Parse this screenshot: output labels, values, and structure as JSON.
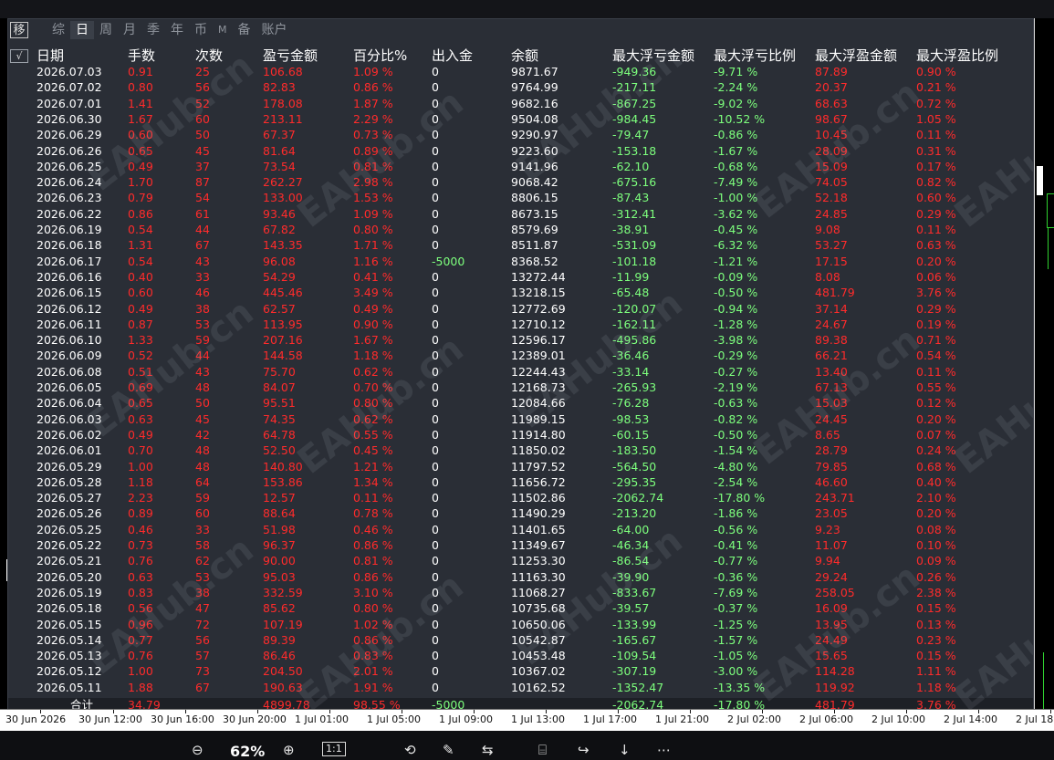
{
  "tabs": {
    "move": "移",
    "items": [
      "综",
      "日",
      "周",
      "月",
      "季",
      "年",
      "币",
      "M",
      "备",
      "账户"
    ],
    "active_index": 1
  },
  "check_label": "√",
  "headers": [
    "日期",
    "手数",
    "次数",
    "盈亏金额",
    "百分比%",
    "出入金",
    "余额",
    "最大浮亏金额",
    "最大浮亏比例",
    "最大浮盈金额",
    "最大浮盈比例"
  ],
  "rows": [
    [
      "2026.07.03",
      "0.91",
      "25",
      "106.68",
      "1.09 %",
      "0",
      "9871.67",
      "-949.36",
      "-9.71 %",
      "87.89",
      "0.90 %"
    ],
    [
      "2026.07.02",
      "0.80",
      "56",
      "82.83",
      "0.86 %",
      "0",
      "9764.99",
      "-217.11",
      "-2.24 %",
      "20.37",
      "0.21 %"
    ],
    [
      "2026.07.01",
      "1.41",
      "52",
      "178.08",
      "1.87 %",
      "0",
      "9682.16",
      "-867.25",
      "-9.02 %",
      "68.63",
      "0.72 %"
    ],
    [
      "2026.06.30",
      "1.67",
      "60",
      "213.11",
      "2.29 %",
      "0",
      "9504.08",
      "-984.45",
      "-10.52 %",
      "98.67",
      "1.05 %"
    ],
    [
      "2026.06.29",
      "0.60",
      "50",
      "67.37",
      "0.73 %",
      "0",
      "9290.97",
      "-79.47",
      "-0.86 %",
      "10.45",
      "0.11 %"
    ],
    [
      "2026.06.26",
      "0.65",
      "45",
      "81.64",
      "0.89 %",
      "0",
      "9223.60",
      "-153.18",
      "-1.67 %",
      "28.09",
      "0.31 %"
    ],
    [
      "2026.06.25",
      "0.49",
      "37",
      "73.54",
      "0.81 %",
      "0",
      "9141.96",
      "-62.10",
      "-0.68 %",
      "15.09",
      "0.17 %"
    ],
    [
      "2026.06.24",
      "1.70",
      "87",
      "262.27",
      "2.98 %",
      "0",
      "9068.42",
      "-675.16",
      "-7.49 %",
      "74.05",
      "0.82 %"
    ],
    [
      "2026.06.23",
      "0.79",
      "54",
      "133.00",
      "1.53 %",
      "0",
      "8806.15",
      "-87.43",
      "-1.00 %",
      "52.18",
      "0.60 %"
    ],
    [
      "2026.06.22",
      "0.86",
      "61",
      "93.46",
      "1.09 %",
      "0",
      "8673.15",
      "-312.41",
      "-3.62 %",
      "24.85",
      "0.29 %"
    ],
    [
      "2026.06.19",
      "0.54",
      "44",
      "67.82",
      "0.80 %",
      "0",
      "8579.69",
      "-38.91",
      "-0.45 %",
      "9.08",
      "0.11 %"
    ],
    [
      "2026.06.18",
      "1.31",
      "67",
      "143.35",
      "1.71 %",
      "0",
      "8511.87",
      "-531.09",
      "-6.32 %",
      "53.27",
      "0.63 %"
    ],
    [
      "2026.06.17",
      "0.54",
      "43",
      "96.08",
      "1.16 %",
      "-5000",
      "8368.52",
      "-101.18",
      "-1.21 %",
      "17.15",
      "0.20 %"
    ],
    [
      "2026.06.16",
      "0.40",
      "33",
      "54.29",
      "0.41 %",
      "0",
      "13272.44",
      "-11.99",
      "-0.09 %",
      "8.08",
      "0.06 %"
    ],
    [
      "2026.06.15",
      "0.60",
      "46",
      "445.46",
      "3.49 %",
      "0",
      "13218.15",
      "-65.48",
      "-0.50 %",
      "481.79",
      "3.76 %"
    ],
    [
      "2026.06.12",
      "0.49",
      "38",
      "62.57",
      "0.49 %",
      "0",
      "12772.69",
      "-120.07",
      "-0.94 %",
      "37.14",
      "0.29 %"
    ],
    [
      "2026.06.11",
      "0.87",
      "53",
      "113.95",
      "0.90 %",
      "0",
      "12710.12",
      "-162.11",
      "-1.28 %",
      "24.67",
      "0.19 %"
    ],
    [
      "2026.06.10",
      "1.33",
      "59",
      "207.16",
      "1.67 %",
      "0",
      "12596.17",
      "-495.86",
      "-3.98 %",
      "89.38",
      "0.71 %"
    ],
    [
      "2026.06.09",
      "0.52",
      "44",
      "144.58",
      "1.18 %",
      "0",
      "12389.01",
      "-36.46",
      "-0.29 %",
      "66.21",
      "0.54 %"
    ],
    [
      "2026.06.08",
      "0.51",
      "43",
      "75.70",
      "0.62 %",
      "0",
      "12244.43",
      "-33.14",
      "-0.27 %",
      "13.40",
      "0.11 %"
    ],
    [
      "2026.06.05",
      "0.69",
      "48",
      "84.07",
      "0.70 %",
      "0",
      "12168.73",
      "-265.93",
      "-2.19 %",
      "67.13",
      "0.55 %"
    ],
    [
      "2026.06.04",
      "0.65",
      "50",
      "95.51",
      "0.80 %",
      "0",
      "12084.66",
      "-76.28",
      "-0.63 %",
      "15.03",
      "0.12 %"
    ],
    [
      "2026.06.03",
      "0.63",
      "45",
      "74.35",
      "0.62 %",
      "0",
      "11989.15",
      "-98.53",
      "-0.82 %",
      "24.45",
      "0.20 %"
    ],
    [
      "2026.06.02",
      "0.49",
      "42",
      "64.78",
      "0.55 %",
      "0",
      "11914.80",
      "-60.15",
      "-0.50 %",
      "8.65",
      "0.07 %"
    ],
    [
      "2026.06.01",
      "0.70",
      "48",
      "52.50",
      "0.45 %",
      "0",
      "11850.02",
      "-183.50",
      "-1.54 %",
      "28.79",
      "0.24 %"
    ],
    [
      "2026.05.29",
      "1.00",
      "48",
      "140.80",
      "1.21 %",
      "0",
      "11797.52",
      "-564.50",
      "-4.80 %",
      "79.85",
      "0.68 %"
    ],
    [
      "2026.05.28",
      "1.18",
      "64",
      "153.86",
      "1.34 %",
      "0",
      "11656.72",
      "-295.35",
      "-2.54 %",
      "46.60",
      "0.40 %"
    ],
    [
      "2026.05.27",
      "2.23",
      "59",
      "12.57",
      "0.11 %",
      "0",
      "11502.86",
      "-2062.74",
      "-17.80 %",
      "243.71",
      "2.10 %"
    ],
    [
      "2026.05.26",
      "0.89",
      "60",
      "88.64",
      "0.78 %",
      "0",
      "11490.29",
      "-213.20",
      "-1.86 %",
      "23.05",
      "0.20 %"
    ],
    [
      "2026.05.25",
      "0.46",
      "33",
      "51.98",
      "0.46 %",
      "0",
      "11401.65",
      "-64.00",
      "-0.56 %",
      "9.23",
      "0.08 %"
    ],
    [
      "2026.05.22",
      "0.73",
      "58",
      "96.37",
      "0.86 %",
      "0",
      "11349.67",
      "-46.34",
      "-0.41 %",
      "11.07",
      "0.10 %"
    ],
    [
      "2026.05.21",
      "0.76",
      "62",
      "90.00",
      "0.81 %",
      "0",
      "11253.30",
      "-86.54",
      "-0.77 %",
      "9.94",
      "0.09 %"
    ],
    [
      "2026.05.20",
      "0.63",
      "53",
      "95.03",
      "0.86 %",
      "0",
      "11163.30",
      "-39.90",
      "-0.36 %",
      "29.24",
      "0.26 %"
    ],
    [
      "2026.05.19",
      "0.83",
      "38",
      "332.59",
      "3.10 %",
      "0",
      "11068.27",
      "-833.67",
      "-7.69 %",
      "258.05",
      "2.38 %"
    ],
    [
      "2026.05.18",
      "0.56",
      "47",
      "85.62",
      "0.80 %",
      "0",
      "10735.68",
      "-39.57",
      "-0.37 %",
      "16.09",
      "0.15 %"
    ],
    [
      "2026.05.15",
      "0.96",
      "72",
      "107.19",
      "1.02 %",
      "0",
      "10650.06",
      "-133.99",
      "-1.25 %",
      "13.95",
      "0.13 %"
    ],
    [
      "2026.05.14",
      "0.77",
      "56",
      "89.39",
      "0.86 %",
      "0",
      "10542.87",
      "-165.67",
      "-1.57 %",
      "24.49",
      "0.23 %"
    ],
    [
      "2026.05.13",
      "0.76",
      "57",
      "86.46",
      "0.83 %",
      "0",
      "10453.48",
      "-109.54",
      "-1.05 %",
      "15.65",
      "0.15 %"
    ],
    [
      "2026.05.12",
      "1.00",
      "73",
      "204.50",
      "2.01 %",
      "0",
      "10367.02",
      "-307.19",
      "-3.00 %",
      "114.28",
      "1.11 %"
    ],
    [
      "2026.05.11",
      "1.88",
      "67",
      "190.63",
      "1.91 %",
      "0",
      "10162.52",
      "-1352.47",
      "-13.35 %",
      "119.92",
      "1.18 %"
    ]
  ],
  "total": [
    "合计",
    "34.79",
    "",
    "4899.78",
    "98.55 %",
    "-5000",
    "",
    "-2062.74",
    "-17.80 %",
    "481.79",
    "3.76 %"
  ],
  "time_axis": [
    "30 Jun 2026",
    "30 Jun 12:00",
    "30 Jun 16:00",
    "30 Jun 20:00",
    "1 Jul 01:00",
    "1 Jul 05:00",
    "1 Jul 09:00",
    "1 Jul 13:00",
    "1 Jul 17:00",
    "1 Jul 21:00",
    "2 Jul 02:00",
    "2 Jul 06:00",
    "2 Jul 10:00",
    "2 Jul 14:00",
    "2 Jul 18"
  ],
  "watermark": "EAHub.cn",
  "toolbar": {
    "zoom": "62%",
    "zoom_out": "⊖",
    "zoom_in": "⊕",
    "fit": "1:1"
  },
  "colors": {
    "panel_bg": "#2a2e36",
    "loss": "#ff2b2b",
    "gain": "#7dff7d",
    "candle": "#2fd12f"
  }
}
